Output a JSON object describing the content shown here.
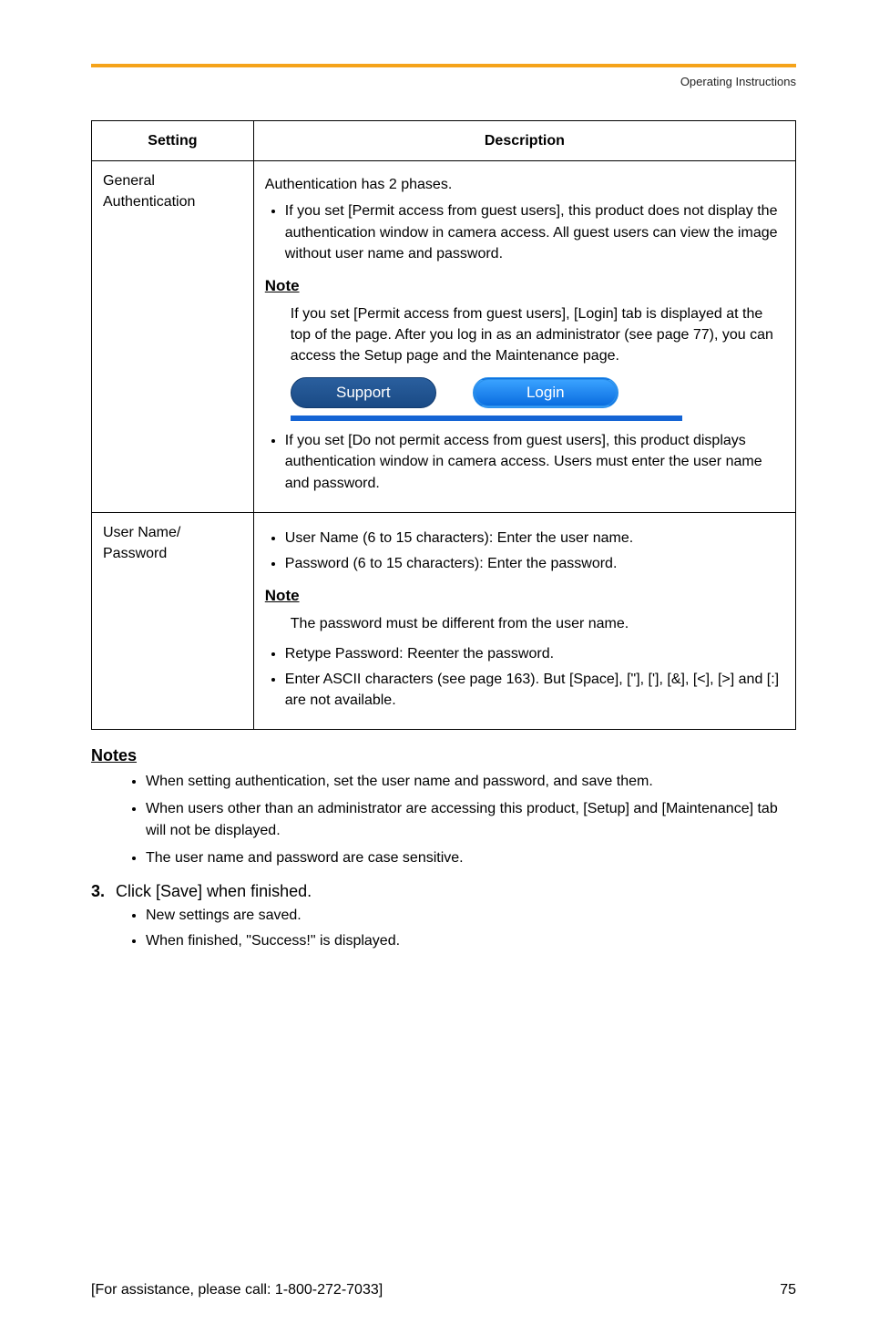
{
  "header": {
    "running_title": "Operating Instructions"
  },
  "table": {
    "headers": {
      "setting": "Setting",
      "description": "Description"
    },
    "rows": {
      "general_auth": {
        "setting": "General Authentication",
        "intro": "Authentication has 2 phases.",
        "bullet1": "If you set [Permit access from guest users], this product does not display the authentication window in camera access. All guest users can view the image without user name and password.",
        "note_label": "Note",
        "note_body": "If you set [Permit access from guest users], [Login] tab is displayed at the top of the page. After you log in as an administrator (see page 77), you can access the Setup page and the Maintenance page.",
        "btn_support": "Support",
        "btn_login": "Login",
        "bullet2": "If you set [Do not permit access from guest users], this product displays authentication window in camera access. Users must enter the user name and password."
      },
      "user_pass": {
        "setting": "User Name/\nPassword",
        "b1": "User Name (6 to 15 characters): Enter the user name.",
        "b2": "Password (6 to 15 characters): Enter the password.",
        "note_label": "Note",
        "note_body": "The password must be different from the user name.",
        "b3": "Retype Password: Reenter the password.",
        "b4": "Enter ASCII characters (see page 163). But [Space], [\"], ['], [&], [<], [>] and [:] are not available."
      }
    }
  },
  "notes_section": {
    "heading": "Notes",
    "items": [
      "When setting authentication, set the user name and password, and save them.",
      "When users other than an administrator are accessing this product, [Setup] and [Maintenance] tab will not be displayed.",
      "The user name and password are case sensitive."
    ]
  },
  "step3": {
    "num": "3.",
    "text": "Click [Save] when finished.",
    "sub": [
      "New settings are saved.",
      "When finished, \"Success!\" is displayed."
    ]
  },
  "footer": {
    "assist": "[For assistance, please call: 1-800-272-7033]",
    "page": "75"
  }
}
